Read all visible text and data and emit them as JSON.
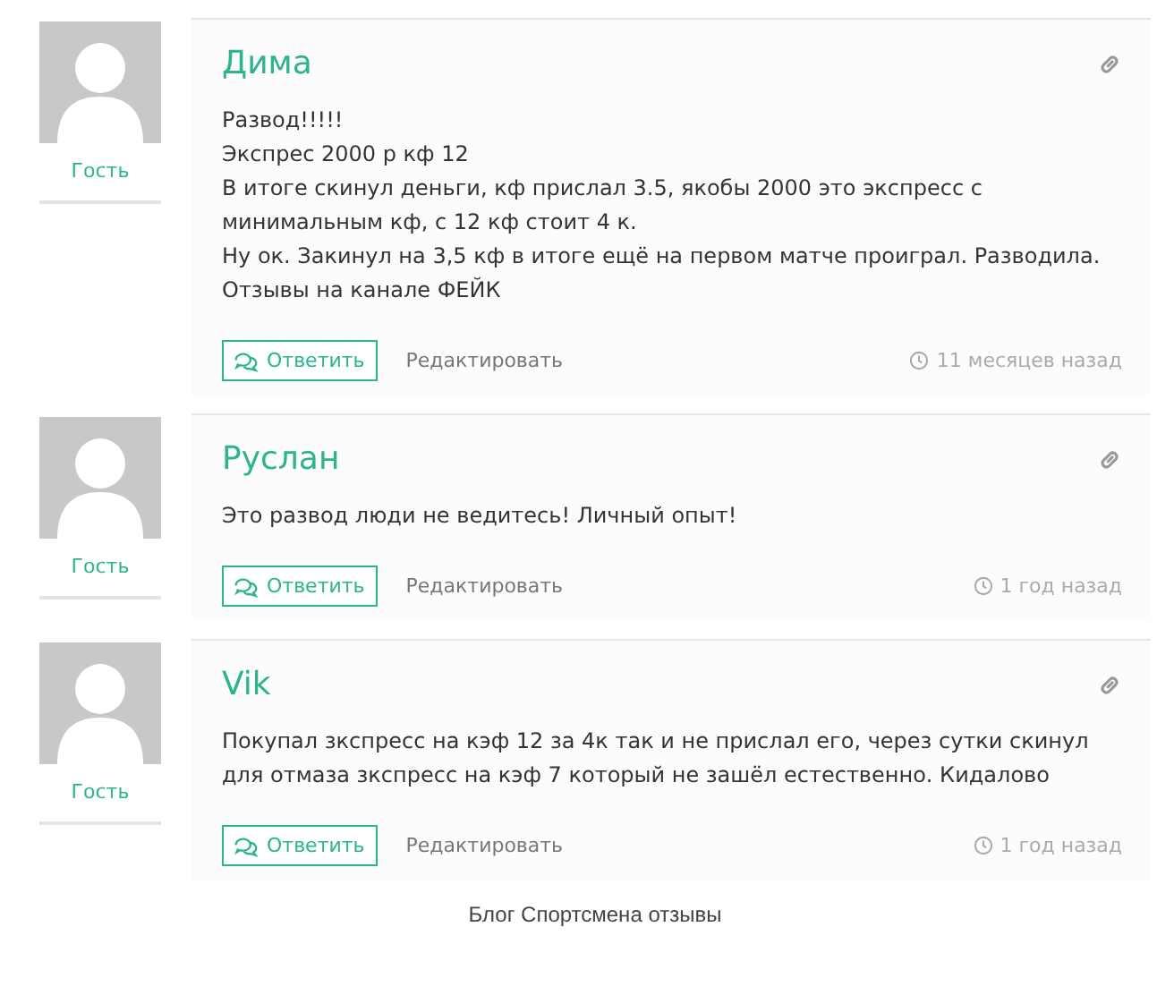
{
  "comments": [
    {
      "author": "Дима",
      "role": "Гость",
      "lines": [
        "Развод!!!!!",
        "Экспрес 2000 р кф 12",
        "В итоге скинул деньги, кф прислал 3.5, якобы 2000 это экспресс с минимальным кф, с 12 кф стоит 4 к.",
        "Ну ок. Закинул на 3,5 кф в итоге ещё на первом матче проиграл. Разводила.",
        "Отзывы на канале ФЕЙК"
      ],
      "reply": "Ответить",
      "edit": "Редактировать",
      "time": "11 месяцев назад"
    },
    {
      "author": "Руслан",
      "role": "Гость",
      "lines": [
        "Это развод люди не ведитесь! Личный опыт!"
      ],
      "reply": "Ответить",
      "edit": "Редактировать",
      "time": "1 год назад"
    },
    {
      "author": "Vik",
      "role": "Гость",
      "lines": [
        "Покупал зкспресс на кэф 12 за 4к так и не прислал его, через сутки скинул для отмаза зкспресс на кэф 7 который не зашёл естественно. Кидалово"
      ],
      "reply": "Ответить",
      "edit": "Редактировать",
      "time": "1 год назад"
    }
  ],
  "caption": "Блог Спортсмена отзывы"
}
